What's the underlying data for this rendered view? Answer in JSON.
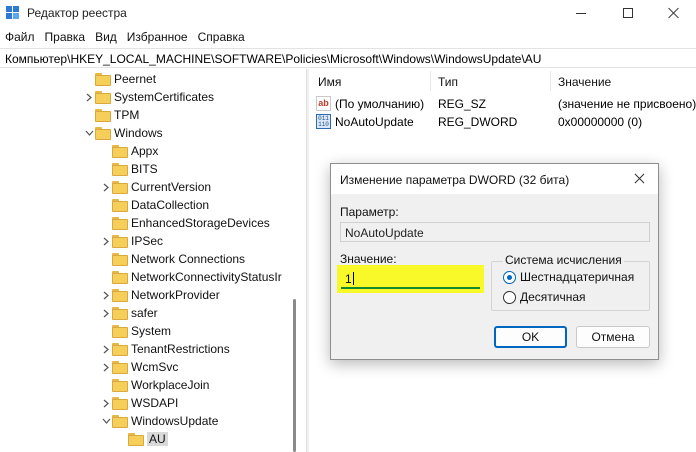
{
  "window": {
    "title": "Редактор реестра"
  },
  "menu": [
    "Файл",
    "Правка",
    "Вид",
    "Избранное",
    "Справка"
  ],
  "address": "Компьютер\\HKEY_LOCAL_MACHINE\\SOFTWARE\\Policies\\Microsoft\\Windows\\WindowsUpdate\\AU",
  "tree": [
    {
      "label": "Peernet",
      "chevron": "none"
    },
    {
      "label": "SystemCertificates",
      "chevron": "right"
    },
    {
      "label": "TPM",
      "chevron": "none"
    },
    {
      "label": "Windows",
      "chevron": "down"
    },
    {
      "label": "Appx",
      "chevron": "none"
    },
    {
      "label": "BITS",
      "chevron": "none"
    },
    {
      "label": "CurrentVersion",
      "chevron": "right"
    },
    {
      "label": "DataCollection",
      "chevron": "none"
    },
    {
      "label": "EnhancedStorageDevices",
      "chevron": "none"
    },
    {
      "label": "IPSec",
      "chevron": "right"
    },
    {
      "label": "Network Connections",
      "chevron": "none"
    },
    {
      "label": "NetworkConnectivityStatusIr",
      "chevron": "none"
    },
    {
      "label": "NetworkProvider",
      "chevron": "right"
    },
    {
      "label": "safer",
      "chevron": "right"
    },
    {
      "label": "System",
      "chevron": "none"
    },
    {
      "label": "TenantRestrictions",
      "chevron": "right"
    },
    {
      "label": "WcmSvc",
      "chevron": "right"
    },
    {
      "label": "WorkplaceJoin",
      "chevron": "none"
    },
    {
      "label": "WSDAPI",
      "chevron": "right"
    },
    {
      "label": "WindowsUpdate",
      "chevron": "down"
    },
    {
      "label": "AU",
      "chevron": "none",
      "selected": true
    }
  ],
  "list": {
    "headers": {
      "name": "Имя",
      "type": "Тип",
      "value": "Значение"
    },
    "rows": [
      {
        "icon": "string-value-icon",
        "name": "(По умолчанию)",
        "type": "REG_SZ",
        "value": "(значение не присвоено)"
      },
      {
        "icon": "dword-value-icon",
        "name": "NoAutoUpdate",
        "type": "REG_DWORD",
        "value": "0x00000000 (0)"
      }
    ]
  },
  "dialog": {
    "title": "Изменение параметра DWORD (32 бита)",
    "param_label": "Параметр:",
    "param_value": "NoAutoUpdate",
    "value_label": "Значение:",
    "value": "1",
    "radix_title": "Система исчисления",
    "radix_hex": "Шестнадцатеричная",
    "radix_dec": "Десятичная",
    "radix_selected": "hex",
    "ok": "OK",
    "cancel": "Отмена"
  },
  "colors": {
    "highlight": "#f9f92a",
    "accent": "#0067c0",
    "folder": "#f6cf5b"
  }
}
